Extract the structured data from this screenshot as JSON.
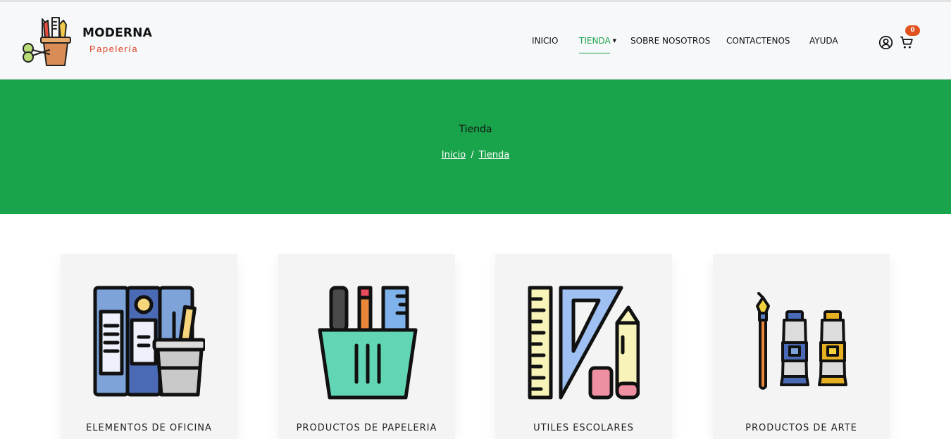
{
  "brand": {
    "name": "MODERNA",
    "subtitle": "Papelería",
    "logo_icon": "stationery-cup-icon"
  },
  "nav": {
    "items": [
      {
        "label": "INICIO",
        "active": false
      },
      {
        "label": "TIENDA",
        "active": true,
        "has_dropdown": true
      },
      {
        "label": "SOBRE NOSOTROS",
        "active": false
      },
      {
        "label": "CONTACTENOS",
        "active": false
      },
      {
        "label": "AYUDA",
        "active": false
      }
    ],
    "icons": {
      "account": "user-circle-icon",
      "cart": "shopping-cart-icon"
    },
    "cart_count": "0"
  },
  "hero": {
    "title": "Tienda",
    "breadcrumb": [
      "Inicio",
      "Tienda"
    ],
    "breadcrumb_separator": "/"
  },
  "categories": [
    {
      "label": "ELEMENTOS DE OFICINA",
      "icon": "office-binders-icon"
    },
    {
      "label": "PRODUCTOS DE PAPELERIA",
      "icon": "pencil-cup-icon"
    },
    {
      "label": "UTILES ESCOLARES",
      "icon": "ruler-square-icon"
    },
    {
      "label": "PRODUCTOS DE ARTE",
      "icon": "paint-tubes-icon"
    }
  ],
  "colors": {
    "accent_green": "#19a34a",
    "brand_red": "#e0452b",
    "badge_orange": "#e0531f",
    "header_bg": "#f7f8fa",
    "card_bg": "#f4f4f4"
  }
}
